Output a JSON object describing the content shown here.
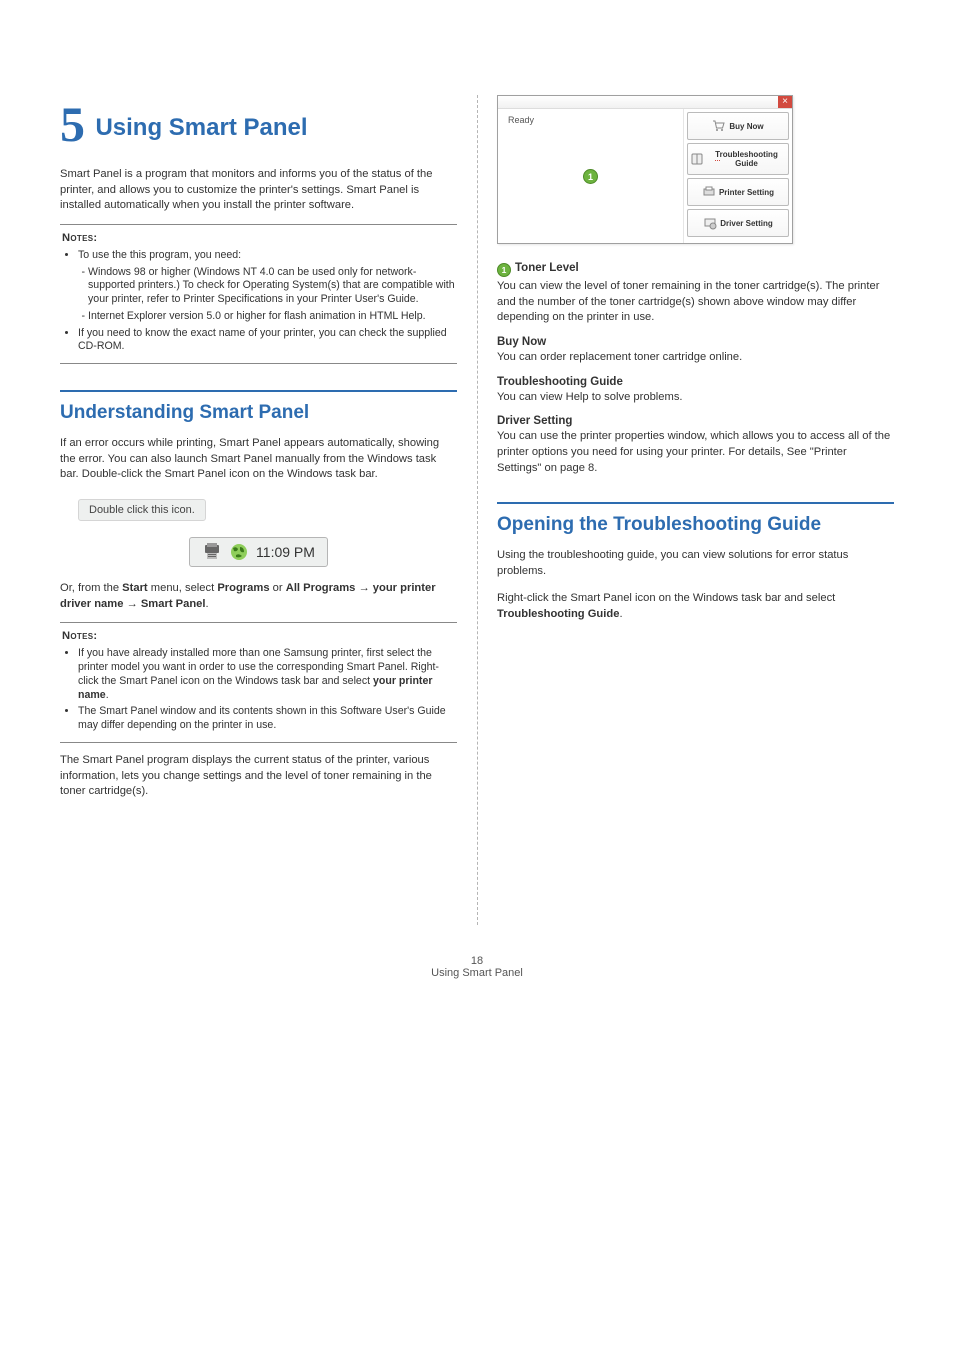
{
  "chapter": {
    "number": "5",
    "title": "Using Smart Panel"
  },
  "intro": "Smart Panel is a program that monitors and informs you of the status of the printer, and allows you to customize the printer's settings. Smart Panel is installed automatically when you install the printer software.",
  "notes1": {
    "heading": "Notes",
    "items": [
      "To use the this program, you need:",
      "If you need to know the exact name of your printer, you can check the supplied CD-ROM."
    ],
    "sub": [
      "Windows 98 or higher (Windows NT 4.0 can be used only for network-supported printers.) To check for Operating System(s) that are compatible with your printer, refer to Printer Specifications in your Printer User's Guide.",
      "Internet Explorer version 5.0 or higher for flash animation in HTML Help."
    ]
  },
  "section1": {
    "title": "Understanding Smart Panel",
    "p1": "If an error occurs while printing, Smart Panel appears automatically, showing the error. You can also launch Smart Panel manually from the Windows task bar. Double-click the Smart Panel icon on the Windows task bar.",
    "callout": "Double click this icon.",
    "tray_time": "11:09 PM",
    "p2a": "Or, from the ",
    "p2b": "Start",
    "p2c": " menu, select ",
    "p2d": "Programs",
    "p2e": " or ",
    "p2f": "All Programs",
    "arrow1": " → ",
    "p2g": "your printer driver name",
    "arrow2": " → ",
    "p2h": "Smart Panel",
    "p2i": "."
  },
  "notes2": {
    "heading": "Notes",
    "item1a": "If you have already installed more than one Samsung printer, first select the printer model you want in order to use the corresponding Smart Panel. Right-click the Smart Panel icon on the Windows task bar and select ",
    "item1b": "your printer name",
    "item1c": ".",
    "item2": "The Smart Panel window and its contents shown in this Software User's Guide may differ depending on the printer in use."
  },
  "right_intro": "The Smart Panel program displays the current status of the printer, various information, lets you change settings and the level of toner remaining in the toner cartridge(s).",
  "sp_window": {
    "status": "Ready",
    "badge": "1",
    "buttons": {
      "buy": "Buy Now",
      "trouble": "Troubleshooting Guide",
      "printer": "Printer Setting",
      "driver": "Driver Setting"
    }
  },
  "features": {
    "f1": {
      "badge": "1",
      "title": "Toner Level",
      "text": "You can view the level of toner remaining in the toner cartridge(s). The printer and the number of the toner cartridge(s) shown above window may differ depending on the printer in use."
    },
    "f2": {
      "title": "Buy Now",
      "text": "You can order replacement toner cartridge online."
    },
    "f3": {
      "title": "Troubleshooting Guide",
      "text": "You can view Help to solve problems."
    },
    "f4": {
      "title": "Driver Setting",
      "text": "You can use the printer properties window, which allows you to access all of the printer options you need for using your printer. For details, See \"Printer Settings\" on page 8."
    }
  },
  "section2": {
    "title": "Opening the Troubleshooting Guide",
    "p1": "Using the troubleshooting guide, you can view solutions for error status problems.",
    "p2a": "Right-click the Smart Panel icon on the Windows task bar and select ",
    "p2b": "Troubleshooting Guide",
    "p2c": "."
  },
  "footer": {
    "page": "18",
    "label": "Using Smart Panel"
  }
}
